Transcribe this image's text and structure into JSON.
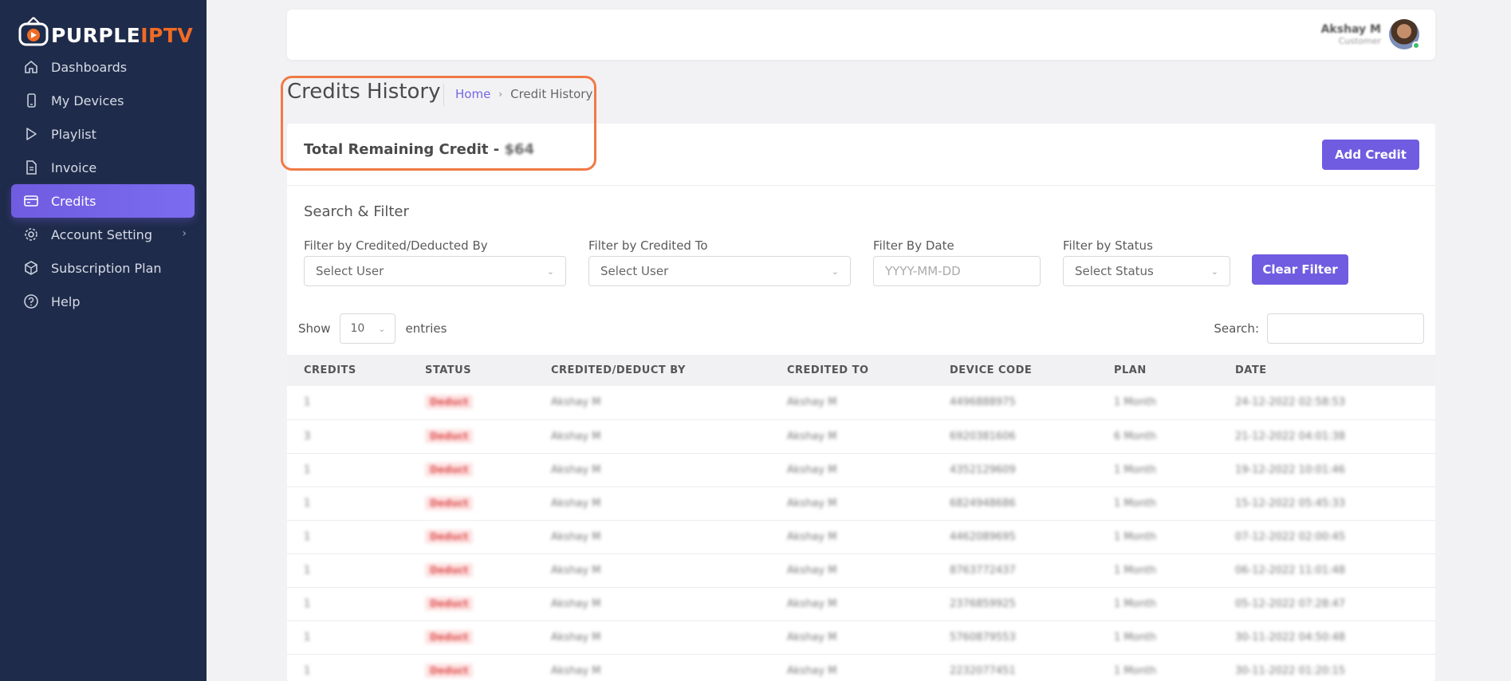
{
  "app": {
    "logo_main": "PURPLE",
    "logo_accent": "IPTV",
    "colors": {
      "sidebar": "#1f2b4a",
      "accent": "#6f5ce0",
      "logo_accent": "#f06b24",
      "highlight": "#f07a45"
    }
  },
  "sidebar": {
    "items": [
      {
        "label": "Dashboards",
        "icon": "home-icon"
      },
      {
        "label": "My Devices",
        "icon": "phone-icon"
      },
      {
        "label": "Playlist",
        "icon": "play-icon"
      },
      {
        "label": "Invoice",
        "icon": "document-icon"
      },
      {
        "label": "Credits",
        "icon": "card-icon",
        "active": true
      },
      {
        "label": "Account Setting",
        "icon": "gear-icon",
        "has_submenu": true
      },
      {
        "label": "Subscription Plan",
        "icon": "box-icon"
      },
      {
        "label": "Help",
        "icon": "help-icon"
      }
    ]
  },
  "header": {
    "user_name": "Akshay M",
    "user_role": "Customer"
  },
  "page": {
    "title": "Credits History",
    "breadcrumb_home": "Home",
    "breadcrumb_current": "Credit History"
  },
  "credit": {
    "label": "Total Remaining Credit - ",
    "value": "$64",
    "add_button": "Add Credit"
  },
  "filters": {
    "title": "Search & Filter",
    "by_user_label": "Filter by Credited/Deducted By",
    "by_user_value": "Select User",
    "to_label": "Filter by Credited To",
    "to_value": "Select User",
    "date_label": "Filter By Date",
    "date_placeholder": "YYYY-MM-DD",
    "status_label": "Filter by Status",
    "status_value": "Select Status",
    "clear_button": "Clear Filter"
  },
  "table": {
    "show_label": "Show",
    "entries_value": "10",
    "entries_label": "entries",
    "search_label": "Search:",
    "columns": [
      "CREDITS",
      "STATUS",
      "CREDITED/DEDUCT BY",
      "CREDITED TO",
      "DEVICE CODE",
      "PLAN",
      "DATE"
    ],
    "rows": [
      [
        "1",
        "Deduct",
        "Akshay M",
        "Akshay M",
        "4496888975",
        "1 Month",
        "24-12-2022 02:58:53"
      ],
      [
        "3",
        "Deduct",
        "Akshay M",
        "Akshay M",
        "6920381606",
        "6 Month",
        "21-12-2022 04:01:38"
      ],
      [
        "1",
        "Deduct",
        "Akshay M",
        "Akshay M",
        "4352129609",
        "1 Month",
        "19-12-2022 10:01:46"
      ],
      [
        "1",
        "Deduct",
        "Akshay M",
        "Akshay M",
        "6824948686",
        "1 Month",
        "15-12-2022 05:45:33"
      ],
      [
        "1",
        "Deduct",
        "Akshay M",
        "Akshay M",
        "4462089695",
        "1 Month",
        "07-12-2022 02:00:45"
      ],
      [
        "1",
        "Deduct",
        "Akshay M",
        "Akshay M",
        "8763772437",
        "1 Month",
        "06-12-2022 11:01:48"
      ],
      [
        "1",
        "Deduct",
        "Akshay M",
        "Akshay M",
        "2376859925",
        "1 Month",
        "05-12-2022 07:28:47"
      ],
      [
        "1",
        "Deduct",
        "Akshay M",
        "Akshay M",
        "5760879553",
        "1 Month",
        "30-11-2022 04:50:48"
      ],
      [
        "1",
        "Deduct",
        "Akshay M",
        "Akshay M",
        "2232077451",
        "1 Month",
        "30-11-2022 01:20:15"
      ]
    ]
  }
}
